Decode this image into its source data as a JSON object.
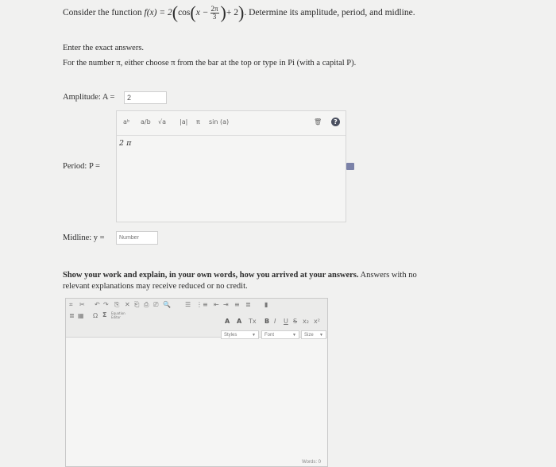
{
  "question": {
    "prefix": "Consider the function",
    "fx": "f(x) = 2",
    "cos": "cos",
    "x_minus": "x −",
    "frac_num": "2π",
    "frac_den": "3",
    "plus2": "+ 2",
    "suffix": ". Determine its amplitude, period, and midline."
  },
  "instructions": {
    "line1": "Enter the exact answers.",
    "line2": "For the number π, either choose π from the bar at the top or type in Pi (with a capital P)."
  },
  "amplitude": {
    "label": "Amplitude: A =",
    "value": "2"
  },
  "period": {
    "label": "Period: P =",
    "value": "2 π",
    "toolbar": {
      "power": "aᵇ",
      "fraction": "a/b",
      "sqrt": "√a",
      "abs": "|a|",
      "pi": "π",
      "sin": "sin (a)",
      "trash": "🗑",
      "help": "?"
    }
  },
  "midline": {
    "label": "Midline: y =",
    "placeholder": "Number"
  },
  "work": {
    "bold_text": "Show your work and explain, in your own words, how you arrived at your answers.",
    "rest_text": " Answers with no relevant explanations may receive reduced or no credit."
  },
  "rte": {
    "row1_icons": [
      "⌗",
      "✂",
      "↶",
      "↷",
      "⎘",
      "✕",
      "⎗",
      "⎙",
      "⎚",
      "🔍",
      "☰",
      "⋮≡",
      "⇤",
      "⇥",
      "≡",
      "≣",
      "▮"
    ],
    "row2_icons": [
      "≣",
      "▦",
      "Ω",
      "Σ"
    ],
    "equation_editor": "Equation Editor",
    "format": [
      "A",
      "A",
      "Tx",
      "B",
      "I",
      "U",
      "S",
      "x₂",
      "x²"
    ],
    "styles": "Styles",
    "font": "Font",
    "size": "Size",
    "words": "Words: 0"
  }
}
